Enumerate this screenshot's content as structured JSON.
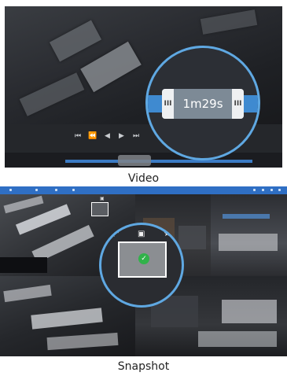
{
  "video_panel": {
    "zoom_time": "1m29s",
    "handle_left": "III",
    "handle_right": "III",
    "controls": {
      "skip_back_icon": "⏮",
      "step_back_icon": "⏪",
      "play_reverse_icon": "◀",
      "play_icon": "▶",
      "skip_forward_icon": "⏭"
    },
    "caption": "Video"
  },
  "snapshot_panel": {
    "tools": {
      "expand_icon": "⤢",
      "camera_icon": "▣",
      "star_icon": "★"
    },
    "check_icon": "✓",
    "caption": "Snapshot"
  },
  "colors": {
    "accent_blue": "#5fa8e2",
    "bar_blue": "#3f8ad0",
    "topbar_blue": "#2f6fc4",
    "check_green": "#31b24a"
  }
}
